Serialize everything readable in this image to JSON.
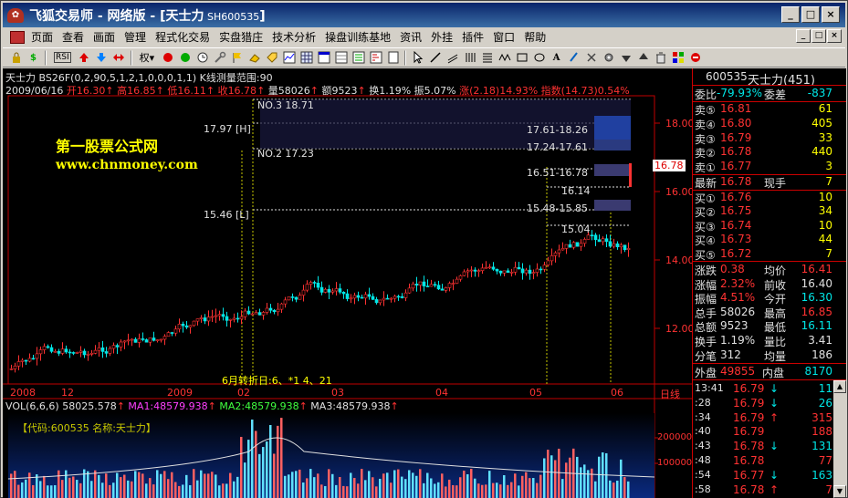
{
  "window": {
    "title": "飞狐交易师 - 网络版 - [天士力",
    "title_code": " SH600535",
    "title_end": "]",
    "buttons": [
      "_",
      "□",
      "×"
    ]
  },
  "menu": {
    "items": [
      "页面",
      "查看",
      "画面",
      "管理",
      "程式化交易",
      "实盘猎庄",
      "技术分析",
      "操盘训练基地",
      "资讯",
      "外挂",
      "插件",
      "窗口",
      "帮助"
    ],
    "right_buttons": [
      "_",
      "□",
      "×"
    ]
  },
  "toolbar": {
    "rsi_label": "RSI",
    "quan_label": "权",
    "bar_label": "$"
  },
  "chart": {
    "header_line1": "天士力 BS26F(0,2,90,5,1,2,1,0,0,0,1,1) K线测量范围:90",
    "date": "2009/06/16",
    "open_label": "开",
    "open": "16.30",
    "high_label": "高",
    "high": "16.85",
    "low_label": "低",
    "low": "16.11",
    "close_label": "收",
    "close": "16.78",
    "vol_label": "量",
    "vol": "58026",
    "amt_label": "额",
    "amt": "9523",
    "turn_label": "换",
    "turn": "1.19%",
    "amp_label": "振",
    "amp": "5.07%",
    "chg_label": "涨",
    "chg": "(2.18)",
    "chg_pct": "14.93%",
    "idx_label": "指数",
    "idx": "(14.73)",
    "idx_pct": "0.54%",
    "watermark1": "第一股票公式网",
    "watermark2": "www.chnmoney.com",
    "annotations": {
      "no3": "NO.3 18.71",
      "no2": "NO.2 17.23",
      "h_label": "17.97 [H]",
      "l_label": "15.46 [L]",
      "z1": "17.61-18.26",
      "z2": "17.24-17.61",
      "z3": "16.51-16.78",
      "z4": "16.14",
      "z5": "15.48-15.85",
      "z6": "15.04",
      "turn_note": "6月转折日:6、*1 4、21"
    },
    "y_ticks": [
      "18.00",
      "16.00",
      "14.00",
      "12.00"
    ],
    "last_price": "16.78",
    "x_ticks": [
      "2008",
      "12",
      "2009",
      "02",
      "03",
      "04",
      "05",
      "06"
    ],
    "period": "日线"
  },
  "vol_panel": {
    "header": "VOL(6,6,6)",
    "vol_val": "58025.578",
    "ma1": "MA1:48579.938",
    "ma2": "MA2:48579.938",
    "ma3": "MA3:48579.938",
    "code_box": "【代码:600535 名称:天士力】",
    "y_ticks": [
      "200000",
      "100000"
    ]
  },
  "quote": {
    "code": "600535",
    "name": "天士力(451)",
    "weibi_label": "委比",
    "weibi": "-79.93%",
    "weicha_label": "委差",
    "weicha": "-837",
    "sells": [
      {
        "label": "卖⑤",
        "price": "16.81",
        "vol": "61"
      },
      {
        "label": "卖④",
        "price": "16.80",
        "vol": "405"
      },
      {
        "label": "卖③",
        "price": "16.79",
        "vol": "33"
      },
      {
        "label": "卖②",
        "price": "16.78",
        "vol": "440"
      },
      {
        "label": "卖①",
        "price": "16.77",
        "vol": "3"
      }
    ],
    "latest_label": "最新",
    "latest": "16.78",
    "xianshou_label": "现手",
    "xianshou": "7",
    "buys": [
      {
        "label": "买①",
        "price": "16.76",
        "vol": "10"
      },
      {
        "label": "买②",
        "price": "16.75",
        "vol": "34"
      },
      {
        "label": "买③",
        "price": "16.74",
        "vol": "10"
      },
      {
        "label": "买④",
        "price": "16.73",
        "vol": "44"
      },
      {
        "label": "买⑤",
        "price": "16.72",
        "vol": "7"
      }
    ],
    "stats": [
      {
        "l1": "涨跌",
        "v1": "0.38",
        "l2": "均价",
        "v2": "16.41"
      },
      {
        "l1": "涨幅",
        "v1": "2.32%",
        "l2": "前收",
        "v2": "16.40"
      },
      {
        "l1": "振幅",
        "v1": "4.51%",
        "l2": "今开",
        "v2": "16.30"
      },
      {
        "l1": "总手",
        "v1": "58026",
        "l2": "最高",
        "v2": "16.85"
      },
      {
        "l1": "总额",
        "v1": "9523",
        "l2": "最低",
        "v2": "16.11"
      },
      {
        "l1": "换手",
        "v1": "1.19%",
        "l2": "量比",
        "v2": "3.41"
      },
      {
        "l1": "分笔",
        "v1": "312",
        "l2": "均量",
        "v2": "186"
      }
    ],
    "outer_label": "外盘",
    "outer": "49855",
    "inner_label": "内盘",
    "inner": "8170",
    "ticks": [
      {
        "t": "13:41",
        "p": "16.79",
        "d": "↓",
        "v": "11"
      },
      {
        "t": ":28",
        "p": "16.79",
        "d": "↓",
        "v": "26"
      },
      {
        "t": ":34",
        "p": "16.79",
        "d": "↑",
        "v": "315"
      },
      {
        "t": ":40",
        "p": "16.79",
        "d": "",
        "v": "188"
      },
      {
        "t": ":43",
        "p": "16.78",
        "d": "↓",
        "v": "131"
      },
      {
        "t": ":48",
        "p": "16.78",
        "d": "",
        "v": "77"
      },
      {
        "t": ":54",
        "p": "16.77",
        "d": "↓",
        "v": "163"
      },
      {
        "t": ":58",
        "p": "16.78",
        "d": "↑",
        "v": "7"
      }
    ]
  },
  "colors": {
    "up": "#ff3232",
    "down": "#00e6e6",
    "grid": "#c00000"
  }
}
